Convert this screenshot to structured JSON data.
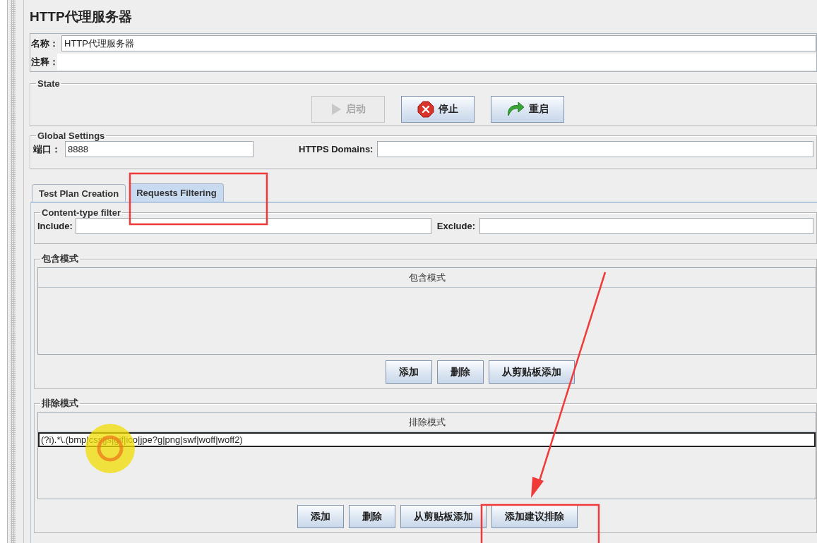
{
  "title": "HTTP代理服务器",
  "name_field": {
    "label": "名称：",
    "value": "HTTP代理服务器"
  },
  "comment_field": {
    "label": "注释："
  },
  "state": {
    "legend": "State",
    "buttons": [
      {
        "label": "启动",
        "kind": "play",
        "disabled": true
      },
      {
        "label": "停止",
        "kind": "stop",
        "disabled": false
      },
      {
        "label": "重启",
        "kind": "restart",
        "disabled": false
      }
    ]
  },
  "global_settings": {
    "legend": "Global Settings",
    "port": {
      "label": "端口：",
      "value": "8888"
    },
    "https_domains": {
      "label": "HTTPS Domains:"
    }
  },
  "tabs": [
    {
      "label": "Test Plan Creation",
      "selected": false
    },
    {
      "label": "Requests Filtering",
      "selected": true
    }
  ],
  "content_type_filter": {
    "legend": "Content-type filter",
    "include": {
      "label": "Include:"
    },
    "exclude": {
      "label": "Exclude:"
    }
  },
  "include_patterns": {
    "legend": "包含模式",
    "column": "包含模式",
    "buttons": [
      "添加",
      "删除",
      "从剪贴板添加"
    ]
  },
  "exclude_patterns": {
    "legend": "排除模式",
    "column": "排除模式",
    "rows": [
      {
        "text": "(?i).*\\.(bmp|css|js|gif|ico|jpe?g|png|swf|woff|woff2)",
        "selected": true
      }
    ],
    "buttons": [
      "添加",
      "删除",
      "从剪贴板添加",
      "添加建议排除"
    ]
  },
  "annotations": [
    {
      "kind": "box"
    },
    {
      "kind": "arrow"
    },
    {
      "kind": "box"
    },
    {
      "kind": "cursor"
    }
  ]
}
